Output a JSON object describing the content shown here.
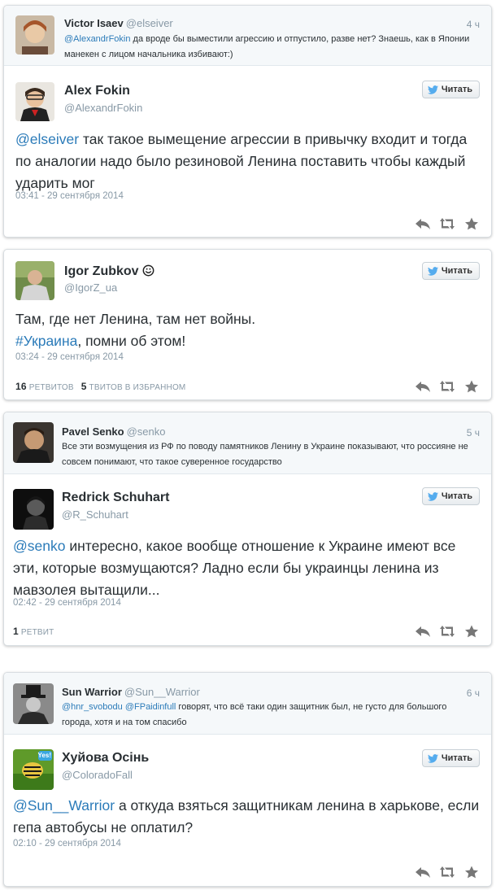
{
  "embeds": [
    {
      "parent": {
        "name": "Victor Isaev",
        "handle": "@elseiver",
        "time": "4 ч",
        "mention": "@AlexandrFokin",
        "text": " да вроде бы выместили агрессию и отпустило, разве нет? Знаешь, как в Японии манекен с лицом начальника избивают:)"
      },
      "tweet": {
        "name": "Alex Fokin",
        "handle": "@AlexandrFokin",
        "mention": "@elseiver",
        "text": " так такое вымещение агрессии в привычку входит и тогда по аналогии надо было резиновой Ленина поставить чтобы каждый ударить мог",
        "date": "03:41 - 29 сентября 2014",
        "follow_label": "Читать"
      }
    },
    {
      "tweet": {
        "name": "Igor Zubkov",
        "handle": "@IgorZ_ua",
        "text_line1": "Там, где нет Ленина,  там нет войны.",
        "hashtag": "#Украина",
        "text_line2_rest": ",  помни об этом!",
        "date": "03:24 - 29 сентября 2014",
        "retweets": "16",
        "retweets_label": "РЕТВИТОВ",
        "favorites": "5",
        "favorites_label": "ТВИТОВ В ИЗБРАННОМ",
        "follow_label": "Читать"
      }
    },
    {
      "parent": {
        "name": "Pavel Senko",
        "handle": "@senko",
        "time": "5 ч",
        "text": "Все эти возмущения из РФ по поводу памятников Ленину в Украине показывают, что россияне не совсем понимают, что такое суверенное государство"
      },
      "tweet": {
        "name": "Redrick Schuhart",
        "handle": "@R_Schuhart",
        "mention": "@senko",
        "text": " интересно, какое вообще отношение к Украине имеют все эти, которые возмущаются? Ладно если бы украинцы ленина из мавзолея вытащили...",
        "date": "02:42 - 29 сентября 2014",
        "retweets": "1",
        "retweets_label": "РЕТВИТ",
        "follow_label": "Читать"
      }
    },
    {
      "parent": {
        "name": "Sun Warrior",
        "handle": "@Sun__Warrior",
        "time": "6 ч",
        "mention1": "@hnr_svobodu",
        "mention2": "@FPaidinfull",
        "text": " говорят, что всё таки один защитник был, не густо для большого города, хотя и на том спасибо"
      },
      "tweet": {
        "name": "Хуйова Осінь",
        "handle": "@ColoradoFall",
        "mention": "@Sun__Warrior",
        "text": " а откуда взяться защитникам ленина в харькове, если гепа автобусы не оплатил?",
        "date": "02:10 - 29 сентября 2014",
        "follow_label": "Читать",
        "avatar_badge": "Yes!"
      }
    }
  ],
  "icons": {
    "follow": "twitter-bird-icon",
    "reply": "reply-icon",
    "retweet": "retweet-icon",
    "favorite": "star-icon"
  },
  "colors": {
    "link": "#2b7bb9",
    "muted": "#8899a6",
    "text": "#292f33"
  }
}
